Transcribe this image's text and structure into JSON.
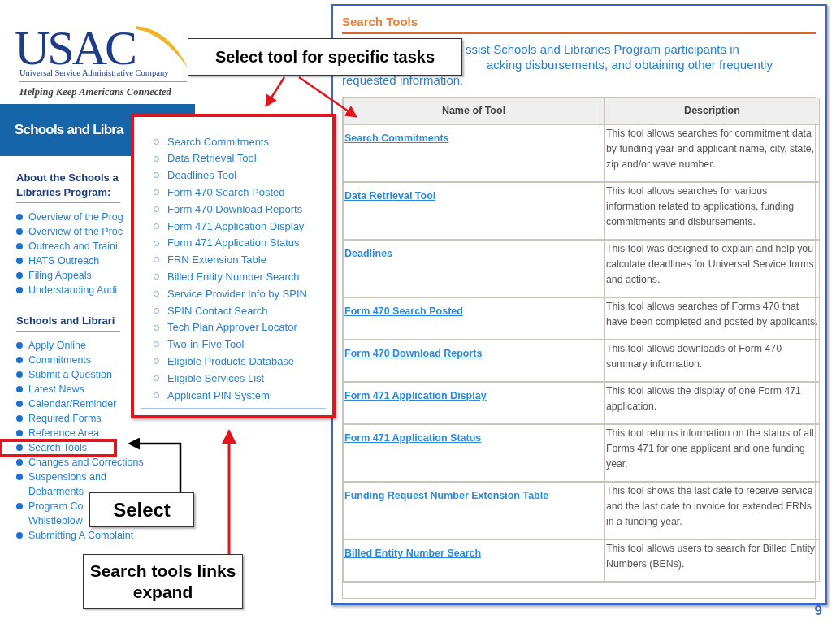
{
  "logo": {
    "wordmark": "USAC",
    "company": "Universal Service Administrative Company",
    "tagline": "Helping Keep Americans Connected"
  },
  "sidebar": {
    "banner": "Schools and Libra",
    "sections": [
      {
        "heading_lines": [
          "About the Schools a",
          "Libraries Program:"
        ],
        "items": [
          {
            "lines": [
              "Overview of the Prog"
            ],
            "highlighted": false
          },
          {
            "lines": [
              "Overview of the Proc"
            ],
            "highlighted": false
          },
          {
            "lines": [
              "Outreach and Traini"
            ],
            "highlighted": false
          },
          {
            "lines": [
              "HATS Outreach"
            ],
            "highlighted": false
          },
          {
            "lines": [
              "Filing Appeals"
            ],
            "highlighted": false
          },
          {
            "lines": [
              "Understanding Audi"
            ],
            "highlighted": false
          }
        ]
      },
      {
        "heading_lines": [
          "Schools and Librari"
        ],
        "items": [
          {
            "lines": [
              "Apply Online"
            ],
            "highlighted": false
          },
          {
            "lines": [
              "Commitments"
            ],
            "highlighted": false
          },
          {
            "lines": [
              "Submit a Question"
            ],
            "highlighted": false
          },
          {
            "lines": [
              "Latest News"
            ],
            "highlighted": false
          },
          {
            "lines": [
              "Calendar/Reminder"
            ],
            "highlighted": false
          },
          {
            "lines": [
              "Required Forms"
            ],
            "highlighted": false
          },
          {
            "lines": [
              "Reference Area"
            ],
            "highlighted": false
          },
          {
            "lines": [
              "Search Tools"
            ],
            "highlighted": true
          },
          {
            "lines": [
              "Changes and Corrections"
            ],
            "highlighted": false
          },
          {
            "lines": [
              "Suspensions and",
              "Debarments"
            ],
            "highlighted": false
          },
          {
            "lines": [
              "Program Co",
              "Whistleblow"
            ],
            "highlighted": false
          },
          {
            "lines": [
              "Submitting A Complaint"
            ],
            "highlighted": false
          }
        ]
      }
    ]
  },
  "search_tools_menu": {
    "items": [
      "Search Commitments",
      "Data Retrieval Tool",
      "Deadlines Tool",
      "Form 470 Search Posted",
      "Form 470 Download Reports",
      "Form 471 Application Display",
      "Form 471 Application Status",
      "FRN Extension Table",
      "Billed Entity Number Search",
      "Service Provider Info by SPIN",
      "SPIN Contact Search",
      "Tech Plan Approver Locator",
      "Two-in-Five Tool",
      "Eligible Products Database",
      "Eligible Services List",
      "Applicant PIN System"
    ]
  },
  "content": {
    "title": "Search Tools",
    "intro_lines": [
      "ssist Schools and Libraries Program participants in",
      "acking disbursements, and obtaining other frequently",
      "requested information."
    ],
    "table": {
      "columns": [
        "Name of Tool",
        "Description"
      ],
      "rows": [
        {
          "name": "Search Commitments",
          "description": "This tool allows searches for commitment data by funding year and applicant name, city, state, zip and/or wave number."
        },
        {
          "name": "Data Retrieval Tool",
          "description": "This tool allows searches for various information related to applications, funding commitments and disbursements."
        },
        {
          "name": "Deadlines",
          "description": "This tool was designed to explain and help you calculate deadlines for Universal Service forms and actions."
        },
        {
          "name": "Form 470 Search Posted",
          "description": "This tool allows searches of Forms 470 that have been completed and posted by applicants."
        },
        {
          "name": "Form 470 Download Reports",
          "description": "This tool allows downloads of Form 470 summary information."
        },
        {
          "name": "Form 471 Application Display",
          "description": "This tool allows the display of one Form 471 application."
        },
        {
          "name": "Form 471 Application Status",
          "description": "This tool returns information on the status of all Forms 471 for one applicant and one funding year."
        },
        {
          "name": "Funding Request Number Extension Table",
          "description": "This tool shows the last date to receive service and the last date to invoice for extended FRNs in a funding year."
        },
        {
          "name": "Billed Entity Number Search",
          "description": "This tool allows users to search for Billed Entity Numbers (BENs)."
        }
      ]
    }
  },
  "callouts": [
    {
      "kind": "tasks",
      "text": "Select tool for specific tasks"
    },
    {
      "kind": "select",
      "text": "Select"
    },
    {
      "kind": "expand",
      "text": "Search tools links expand"
    }
  ],
  "slide_number": "9"
}
